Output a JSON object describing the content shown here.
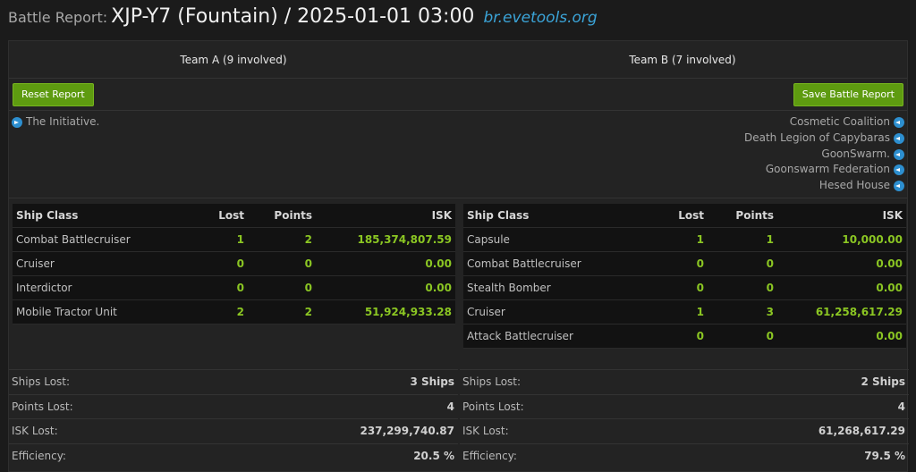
{
  "header": {
    "prefix": "Battle Report:",
    "title": "XJP-Y7 (Fountain) / 2025-01-01 03:00",
    "site": "br.evetools.org"
  },
  "teams": {
    "a": {
      "label": "Team A (9 involved)"
    },
    "b": {
      "label": "Team B (7 involved)"
    }
  },
  "buttons": {
    "reset": "Reset Report",
    "save": "Save Battle Report"
  },
  "alliances": {
    "a": [
      "The Initiative."
    ],
    "b": [
      "Cosmetic Coalition",
      "Death Legion of Capybaras",
      "GoonSwarm.",
      "Goonswarm Federation",
      "Hesed House"
    ]
  },
  "table_headers": {
    "ship_class": "Ship Class",
    "lost": "Lost",
    "points": "Points",
    "isk": "ISK"
  },
  "ship_table_a": [
    {
      "name": "Combat Battlecruiser",
      "lost": "1",
      "points": "2",
      "isk": "185,374,807.59"
    },
    {
      "name": "Cruiser",
      "lost": "0",
      "points": "0",
      "isk": "0.00"
    },
    {
      "name": "Interdictor",
      "lost": "0",
      "points": "0",
      "isk": "0.00"
    },
    {
      "name": "Mobile Tractor Unit",
      "lost": "2",
      "points": "2",
      "isk": "51,924,933.28"
    }
  ],
  "ship_table_b": [
    {
      "name": "Capsule",
      "lost": "1",
      "points": "1",
      "isk": "10,000.00"
    },
    {
      "name": "Combat Battlecruiser",
      "lost": "0",
      "points": "0",
      "isk": "0.00"
    },
    {
      "name": "Stealth Bomber",
      "lost": "0",
      "points": "0",
      "isk": "0.00"
    },
    {
      "name": "Cruiser",
      "lost": "1",
      "points": "3",
      "isk": "61,258,617.29"
    },
    {
      "name": "Attack Battlecruiser",
      "lost": "0",
      "points": "0",
      "isk": "0.00"
    }
  ],
  "summary_labels": {
    "ships_lost": "Ships Lost:",
    "points_lost": "Points Lost:",
    "isk_lost": "ISK Lost:",
    "efficiency": "Efficiency:"
  },
  "summary_a": {
    "ships_lost": "3 Ships",
    "points_lost": "4",
    "isk_lost": "237,299,740.87",
    "efficiency": "20.5 %"
  },
  "summary_b": {
    "ships_lost": "2 Ships",
    "points_lost": "4",
    "isk_lost": "61,268,617.29",
    "efficiency": "79.5 %"
  },
  "colors": {
    "accent_green": "#5e9b10",
    "value_green": "#8bc623",
    "link_blue": "#3ba4d8"
  }
}
